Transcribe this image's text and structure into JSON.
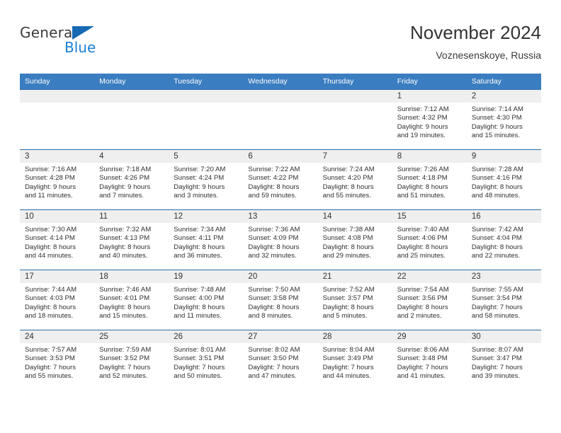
{
  "brand": {
    "name_part1": "General",
    "name_part2": "Blue",
    "triangle_icon": "triangle-icon",
    "accent_color": "#1b7fd4",
    "triangle_color": "#1669b3"
  },
  "header": {
    "title": "November 2024",
    "subtitle": "Voznesenskoye, Russia"
  },
  "theme": {
    "header_bg": "#3a7dc0",
    "header_text": "#ffffff",
    "daynum_band_bg": "#efefef",
    "row_rule": "#2f6ca8",
    "body_text": "#303030"
  },
  "calendar": {
    "weekday_headers": [
      "Sunday",
      "Monday",
      "Tuesday",
      "Wednesday",
      "Thursday",
      "Friday",
      "Saturday"
    ],
    "labels": {
      "sunrise": "Sunrise:",
      "sunset": "Sunset:",
      "daylight": "Daylight:"
    },
    "weeks": [
      [
        {
          "day": "",
          "empty": true
        },
        {
          "day": "",
          "empty": true
        },
        {
          "day": "",
          "empty": true
        },
        {
          "day": "",
          "empty": true
        },
        {
          "day": "",
          "empty": true
        },
        {
          "day": "1",
          "sunrise": "Sunrise: 7:12 AM",
          "sunset": "Sunset: 4:32 PM",
          "daylight_line1": "Daylight: 9 hours",
          "daylight_line2": "and 19 minutes."
        },
        {
          "day": "2",
          "sunrise": "Sunrise: 7:14 AM",
          "sunset": "Sunset: 4:30 PM",
          "daylight_line1": "Daylight: 9 hours",
          "daylight_line2": "and 15 minutes."
        }
      ],
      [
        {
          "day": "3",
          "sunrise": "Sunrise: 7:16 AM",
          "sunset": "Sunset: 4:28 PM",
          "daylight_line1": "Daylight: 9 hours",
          "daylight_line2": "and 11 minutes."
        },
        {
          "day": "4",
          "sunrise": "Sunrise: 7:18 AM",
          "sunset": "Sunset: 4:26 PM",
          "daylight_line1": "Daylight: 9 hours",
          "daylight_line2": "and 7 minutes."
        },
        {
          "day": "5",
          "sunrise": "Sunrise: 7:20 AM",
          "sunset": "Sunset: 4:24 PM",
          "daylight_line1": "Daylight: 9 hours",
          "daylight_line2": "and 3 minutes."
        },
        {
          "day": "6",
          "sunrise": "Sunrise: 7:22 AM",
          "sunset": "Sunset: 4:22 PM",
          "daylight_line1": "Daylight: 8 hours",
          "daylight_line2": "and 59 minutes."
        },
        {
          "day": "7",
          "sunrise": "Sunrise: 7:24 AM",
          "sunset": "Sunset: 4:20 PM",
          "daylight_line1": "Daylight: 8 hours",
          "daylight_line2": "and 55 minutes."
        },
        {
          "day": "8",
          "sunrise": "Sunrise: 7:26 AM",
          "sunset": "Sunset: 4:18 PM",
          "daylight_line1": "Daylight: 8 hours",
          "daylight_line2": "and 51 minutes."
        },
        {
          "day": "9",
          "sunrise": "Sunrise: 7:28 AM",
          "sunset": "Sunset: 4:16 PM",
          "daylight_line1": "Daylight: 8 hours",
          "daylight_line2": "and 48 minutes."
        }
      ],
      [
        {
          "day": "10",
          "sunrise": "Sunrise: 7:30 AM",
          "sunset": "Sunset: 4:14 PM",
          "daylight_line1": "Daylight: 8 hours",
          "daylight_line2": "and 44 minutes."
        },
        {
          "day": "11",
          "sunrise": "Sunrise: 7:32 AM",
          "sunset": "Sunset: 4:13 PM",
          "daylight_line1": "Daylight: 8 hours",
          "daylight_line2": "and 40 minutes."
        },
        {
          "day": "12",
          "sunrise": "Sunrise: 7:34 AM",
          "sunset": "Sunset: 4:11 PM",
          "daylight_line1": "Daylight: 8 hours",
          "daylight_line2": "and 36 minutes."
        },
        {
          "day": "13",
          "sunrise": "Sunrise: 7:36 AM",
          "sunset": "Sunset: 4:09 PM",
          "daylight_line1": "Daylight: 8 hours",
          "daylight_line2": "and 32 minutes."
        },
        {
          "day": "14",
          "sunrise": "Sunrise: 7:38 AM",
          "sunset": "Sunset: 4:08 PM",
          "daylight_line1": "Daylight: 8 hours",
          "daylight_line2": "and 29 minutes."
        },
        {
          "day": "15",
          "sunrise": "Sunrise: 7:40 AM",
          "sunset": "Sunset: 4:06 PM",
          "daylight_line1": "Daylight: 8 hours",
          "daylight_line2": "and 25 minutes."
        },
        {
          "day": "16",
          "sunrise": "Sunrise: 7:42 AM",
          "sunset": "Sunset: 4:04 PM",
          "daylight_line1": "Daylight: 8 hours",
          "daylight_line2": "and 22 minutes."
        }
      ],
      [
        {
          "day": "17",
          "sunrise": "Sunrise: 7:44 AM",
          "sunset": "Sunset: 4:03 PM",
          "daylight_line1": "Daylight: 8 hours",
          "daylight_line2": "and 18 minutes."
        },
        {
          "day": "18",
          "sunrise": "Sunrise: 7:46 AM",
          "sunset": "Sunset: 4:01 PM",
          "daylight_line1": "Daylight: 8 hours",
          "daylight_line2": "and 15 minutes."
        },
        {
          "day": "19",
          "sunrise": "Sunrise: 7:48 AM",
          "sunset": "Sunset: 4:00 PM",
          "daylight_line1": "Daylight: 8 hours",
          "daylight_line2": "and 11 minutes."
        },
        {
          "day": "20",
          "sunrise": "Sunrise: 7:50 AM",
          "sunset": "Sunset: 3:58 PM",
          "daylight_line1": "Daylight: 8 hours",
          "daylight_line2": "and 8 minutes."
        },
        {
          "day": "21",
          "sunrise": "Sunrise: 7:52 AM",
          "sunset": "Sunset: 3:57 PM",
          "daylight_line1": "Daylight: 8 hours",
          "daylight_line2": "and 5 minutes."
        },
        {
          "day": "22",
          "sunrise": "Sunrise: 7:54 AM",
          "sunset": "Sunset: 3:56 PM",
          "daylight_line1": "Daylight: 8 hours",
          "daylight_line2": "and 2 minutes."
        },
        {
          "day": "23",
          "sunrise": "Sunrise: 7:55 AM",
          "sunset": "Sunset: 3:54 PM",
          "daylight_line1": "Daylight: 7 hours",
          "daylight_line2": "and 58 minutes."
        }
      ],
      [
        {
          "day": "24",
          "sunrise": "Sunrise: 7:57 AM",
          "sunset": "Sunset: 3:53 PM",
          "daylight_line1": "Daylight: 7 hours",
          "daylight_line2": "and 55 minutes."
        },
        {
          "day": "25",
          "sunrise": "Sunrise: 7:59 AM",
          "sunset": "Sunset: 3:52 PM",
          "daylight_line1": "Daylight: 7 hours",
          "daylight_line2": "and 52 minutes."
        },
        {
          "day": "26",
          "sunrise": "Sunrise: 8:01 AM",
          "sunset": "Sunset: 3:51 PM",
          "daylight_line1": "Daylight: 7 hours",
          "daylight_line2": "and 50 minutes."
        },
        {
          "day": "27",
          "sunrise": "Sunrise: 8:02 AM",
          "sunset": "Sunset: 3:50 PM",
          "daylight_line1": "Daylight: 7 hours",
          "daylight_line2": "and 47 minutes."
        },
        {
          "day": "28",
          "sunrise": "Sunrise: 8:04 AM",
          "sunset": "Sunset: 3:49 PM",
          "daylight_line1": "Daylight: 7 hours",
          "daylight_line2": "and 44 minutes."
        },
        {
          "day": "29",
          "sunrise": "Sunrise: 8:06 AM",
          "sunset": "Sunset: 3:48 PM",
          "daylight_line1": "Daylight: 7 hours",
          "daylight_line2": "and 41 minutes."
        },
        {
          "day": "30",
          "sunrise": "Sunrise: 8:07 AM",
          "sunset": "Sunset: 3:47 PM",
          "daylight_line1": "Daylight: 7 hours",
          "daylight_line2": "and 39 minutes."
        }
      ]
    ]
  }
}
